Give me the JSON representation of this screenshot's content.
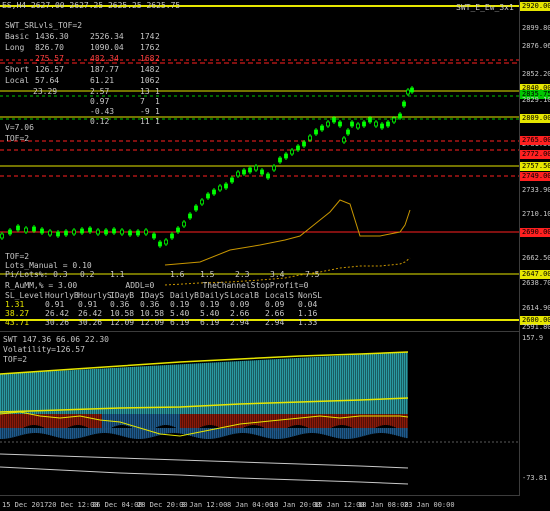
{
  "symbol_header": "ES,H4 2627.00 2627.25 2625.25 2625.75",
  "top_right_label": "SWT_E_Ew_3x1 ...",
  "main_labels": {
    "title": "SWT_SRLvls_TOF=2",
    "table": [
      [
        "Basic",
        "1436.30",
        "2526.34",
        "174",
        "2"
      ],
      [
        "Long",
        "826.70",
        "1090.04",
        "176",
        "2"
      ],
      [
        "Short",
        "126.57",
        "187.77",
        "148",
        "2"
      ],
      [
        "Local",
        "57.64",
        "61.21",
        "106",
        "2"
      ]
    ],
    "red_row": [
      "275.57",
      "482.34",
      "168",
      "2"
    ],
    "small_rows": [
      [
        "23.29",
        "2.57",
        "13",
        "1"
      ],
      [
        "",
        "0.97",
        "7",
        "1"
      ],
      [
        "",
        "-0.43",
        "-9",
        "1"
      ],
      [
        "",
        "0.12",
        "11",
        "1"
      ]
    ],
    "v_label": "V=7.06",
    "tof_label": "TOF=2"
  },
  "stats_block": {
    "tof": "TOF=2",
    "lots": "Lots_Manual = 0.10",
    "pi_row": [
      "Pi/Lots%: 0.3",
      "0.2",
      "1.1",
      "1.6",
      "1.5",
      "2.3",
      "3.4",
      "7.5"
    ],
    "r_row": "R_AuMM,% = 3.00          ADDL=0          TheChannelStopProfit=0",
    "header_row": [
      "SL_Level:",
      "HourlyB",
      "HourlyS",
      "IDayB",
      "IDayS",
      "DailyB",
      "DailyS",
      "LocalB",
      "LocalS",
      "NonSL"
    ],
    "rows": [
      [
        "1.31",
        "0.91",
        "0.91",
        "0.36",
        "0.36",
        "0.19",
        "0.19",
        "0.09",
        "0.09",
        "0.04"
      ],
      [
        "38.27",
        "26.42",
        "26.42",
        "10.58",
        "10.58",
        "5.40",
        "5.40",
        "2.66",
        "2.66",
        "1.16"
      ],
      [
        "43.71",
        "30.26",
        "30.26",
        "12.09",
        "12.09",
        "6.19",
        "6.19",
        "2.94",
        "2.94",
        "1.33"
      ]
    ]
  },
  "price_axis": [
    {
      "v": "2920.00",
      "style": "yellow-box"
    },
    {
      "v": "2899.80",
      "style": "plain"
    },
    {
      "v": "2876.06",
      "style": "plain"
    },
    {
      "v": "2852.20",
      "style": "plain"
    },
    {
      "v": "2840.00",
      "style": "yellow-box"
    },
    {
      "v": "2835.75",
      "style": "green-box"
    },
    {
      "v": "2829.10",
      "style": "plain"
    },
    {
      "v": "2809.00",
      "style": "yellow-box"
    },
    {
      "v": "2781.50",
      "style": "plain"
    },
    {
      "v": "2765.00",
      "style": "red-box"
    },
    {
      "v": "2772.00",
      "style": "red-box"
    },
    {
      "v": "2757.50",
      "style": "yellow-box"
    },
    {
      "v": "2749.00",
      "style": "red-box"
    },
    {
      "v": "2733.90",
      "style": "plain"
    },
    {
      "v": "2710.10",
      "style": "plain"
    },
    {
      "v": "2690.00",
      "style": "red-box"
    },
    {
      "v": "2662.50",
      "style": "plain"
    },
    {
      "v": "2647.00",
      "style": "yellow-box"
    },
    {
      "v": "2638.70",
      "style": "plain"
    },
    {
      "v": "2614.90",
      "style": "plain"
    },
    {
      "v": "2600.00",
      "style": "yellow-box"
    },
    {
      "v": "2591.80",
      "style": "plain"
    }
  ],
  "indicator": {
    "header": "SWT 147.36 66.06 22.30",
    "volatility": "Volatility=126.57",
    "tof": "TOF=2",
    "axis_top": "157.9",
    "axis_bottom": "-73.81"
  },
  "date_axis": [
    "15 Dec 2017",
    "20 Dec 12:00",
    "26 Dec 04:00",
    "28 Dec 20:00",
    "3 Jan 12:00",
    "8 Jan 04:00",
    "10 Jan 20:00",
    "15 Jan 12:00",
    "18 Jan 08:00",
    "23 Jan 00:00"
  ],
  "colors": {
    "candle": "#00ff00",
    "yellow_line": "#e6e600",
    "red_line": "#ff2020",
    "green_line": "#00c800",
    "orange": "#ff8c00",
    "hist_blue": "#1e5a8c",
    "hist_teal": "#2a9aa0",
    "hist_red": "#8b1a0a"
  }
}
